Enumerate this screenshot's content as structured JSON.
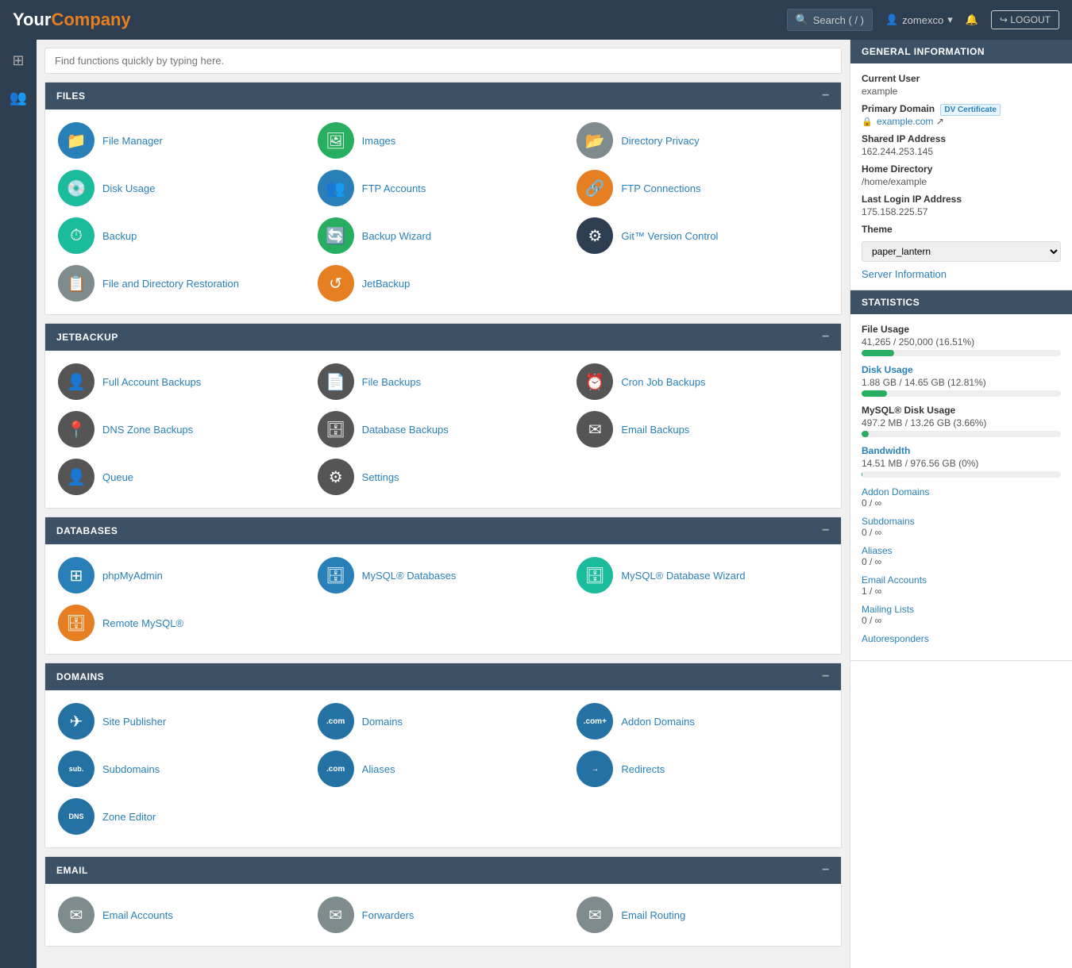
{
  "header": {
    "logo_your": "Your",
    "logo_company": "Company",
    "search_label": "Search ( / )",
    "username": "zomexco",
    "logout_label": "LOGOUT"
  },
  "quick_search": {
    "placeholder": "Find functions quickly by typing here."
  },
  "sections": {
    "files": {
      "title": "FILES",
      "items": [
        {
          "label": "File Manager",
          "icon": "📁",
          "color": "ic-blue"
        },
        {
          "label": "Images",
          "icon": "🖼",
          "color": "ic-green"
        },
        {
          "label": "Directory Privacy",
          "icon": "📂",
          "color": "ic-gray"
        },
        {
          "label": "Disk Usage",
          "icon": "💿",
          "color": "ic-teal"
        },
        {
          "label": "FTP Accounts",
          "icon": "👥",
          "color": "ic-blue"
        },
        {
          "label": "FTP Connections",
          "icon": "🔗",
          "color": "ic-orange"
        },
        {
          "label": "Backup",
          "icon": "⏱",
          "color": "ic-teal"
        },
        {
          "label": "Backup Wizard",
          "icon": "🔄",
          "color": "ic-green"
        },
        {
          "label": "Git™ Version Control",
          "icon": "⚙",
          "color": "ic-dark"
        },
        {
          "label": "File and Directory Restoration",
          "icon": "📋",
          "color": "ic-gray"
        },
        {
          "label": "JetBackup",
          "icon": "↺",
          "color": "ic-orange"
        }
      ]
    },
    "jetbackup": {
      "title": "JETBACKUP",
      "items": [
        {
          "label": "Full Account Backups",
          "icon": "👤",
          "color": "ic-darkgray"
        },
        {
          "label": "File Backups",
          "icon": "📄",
          "color": "ic-darkgray"
        },
        {
          "label": "Cron Job Backups",
          "icon": "⏰",
          "color": "ic-darkgray"
        },
        {
          "label": "DNS Zone Backups",
          "icon": "📍",
          "color": "ic-darkgray"
        },
        {
          "label": "Database Backups",
          "icon": "🗄",
          "color": "ic-darkgray"
        },
        {
          "label": "Email Backups",
          "icon": "✉",
          "color": "ic-darkgray"
        },
        {
          "label": "Queue",
          "icon": "👤",
          "color": "ic-darkgray"
        },
        {
          "label": "Settings",
          "icon": "⚙",
          "color": "ic-darkgray"
        }
      ]
    },
    "databases": {
      "title": "DATABASES",
      "items": [
        {
          "label": "phpMyAdmin",
          "icon": "⊞",
          "color": "ic-blue"
        },
        {
          "label": "MySQL® Databases",
          "icon": "🗄",
          "color": "ic-blue"
        },
        {
          "label": "MySQL® Database Wizard",
          "icon": "🗄",
          "color": "ic-teal"
        },
        {
          "label": "Remote MySQL®",
          "icon": "🗄",
          "color": "ic-orange"
        }
      ]
    },
    "domains": {
      "title": "DOMAINS",
      "items": [
        {
          "label": "Site Publisher",
          "icon": "✈",
          "color": "ic-darkblue"
        },
        {
          "label": "Domains",
          "icon": ".com",
          "color": "ic-darkblue"
        },
        {
          "label": "Addon Domains",
          "icon": ".com+",
          "color": "ic-darkblue"
        },
        {
          "label": "Subdomains",
          "icon": "sub.",
          "color": "ic-darkblue"
        },
        {
          "label": "Aliases",
          "icon": ".com",
          "color": "ic-darkblue"
        },
        {
          "label": "Redirects",
          "icon": ".com→",
          "color": "ic-darkblue"
        },
        {
          "label": "Zone Editor",
          "icon": "DNS",
          "color": "ic-darkblue"
        }
      ]
    },
    "email": {
      "title": "EMAIL",
      "items": [
        {
          "label": "Email Accounts",
          "icon": "✉",
          "color": "ic-gray"
        },
        {
          "label": "Forwarders",
          "icon": "✉→",
          "color": "ic-gray"
        },
        {
          "label": "Email Routing",
          "icon": "✉⟳",
          "color": "ic-gray"
        }
      ]
    }
  },
  "right_panel": {
    "general_info": {
      "title": "GENERAL INFORMATION",
      "current_user_label": "Current User",
      "current_user": "example",
      "primary_domain_label": "Primary Domain",
      "dv_cert_label": "DV Certificate",
      "domain": "example.com",
      "shared_ip_label": "Shared IP Address",
      "shared_ip": "162.244.253.145",
      "home_dir_label": "Home Directory",
      "home_dir": "/home/example",
      "last_login_label": "Last Login IP Address",
      "last_login_ip": "175.158.225.57",
      "theme_label": "Theme",
      "theme_value": "paper_lantern",
      "server_info_label": "Server Information"
    },
    "statistics": {
      "title": "STATISTICS",
      "file_usage_label": "File Usage",
      "file_usage_value": "41,265 / 250,000   (16.51%)",
      "file_usage_pct": 16.51,
      "disk_usage_label": "Disk Usage",
      "disk_usage_value": "1.88 GB / 14.65 GB  (12.81%)",
      "disk_usage_pct": 12.81,
      "mysql_label": "MySQL® Disk Usage",
      "mysql_value": "497.2 MB / 13.26 GB  (3.66%)",
      "mysql_pct": 3.66,
      "bandwidth_label": "Bandwidth",
      "bandwidth_value": "14.51 MB / 976.56 GB  (0%)",
      "bandwidth_pct": 0.1,
      "stats": [
        {
          "label": "Addon Domains",
          "value": "0 / ∞"
        },
        {
          "label": "Subdomains",
          "value": "0 / ∞"
        },
        {
          "label": "Aliases",
          "value": "0 / ∞"
        },
        {
          "label": "Email Accounts",
          "value": "1 / ∞"
        },
        {
          "label": "Mailing Lists",
          "value": "0 / ∞"
        },
        {
          "label": "Autoresponders",
          "value": ""
        }
      ]
    }
  }
}
